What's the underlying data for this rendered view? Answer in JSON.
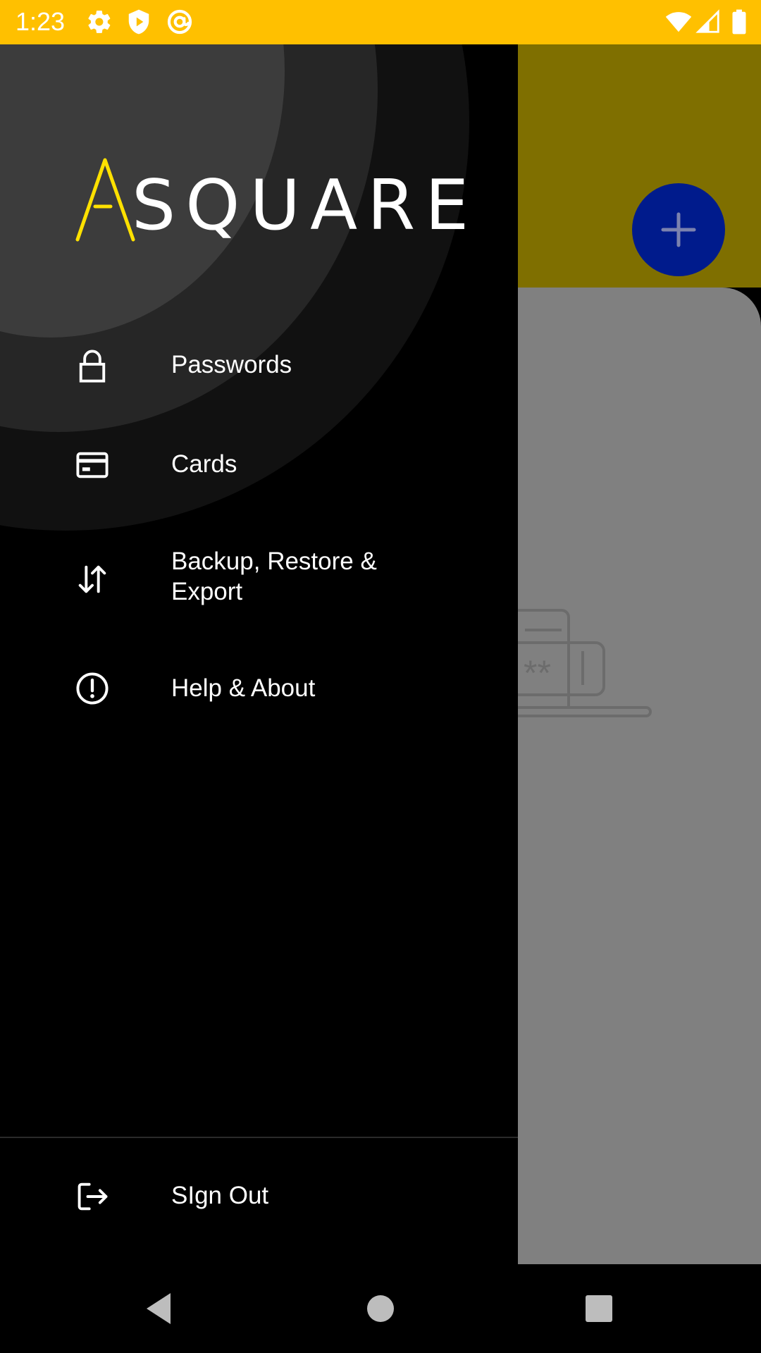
{
  "status_bar": {
    "time": "1:23",
    "background_color": "#FFC000",
    "left_icons": [
      "gear-icon",
      "shield-icon",
      "at-sign-icon"
    ],
    "right_icons": [
      "wifi-icon",
      "cellular-icon",
      "battery-icon"
    ]
  },
  "drawer": {
    "logo": {
      "accent_letter": "A",
      "text": "SQUARE",
      "accent_color": "#FFE100"
    },
    "menu_items": [
      {
        "label": "Passwords",
        "icon": "lock-icon"
      },
      {
        "label": "Cards",
        "icon": "credit-card-icon"
      },
      {
        "label": "Backup, Restore & Export",
        "icon": "swap-vertical-icon"
      },
      {
        "label": "Help & About",
        "icon": "info-circle-icon"
      }
    ],
    "footer": {
      "label": "SIgn Out",
      "icon": "logout-icon"
    }
  },
  "background_app": {
    "header_color": "#7F6F00",
    "content_color": "#808080",
    "fab_icon": "plus-icon",
    "fab_color": "#001B8C",
    "illustration_text": "**"
  },
  "nav_bar": {
    "buttons": [
      "back-icon",
      "home-icon",
      "recents-icon"
    ]
  }
}
